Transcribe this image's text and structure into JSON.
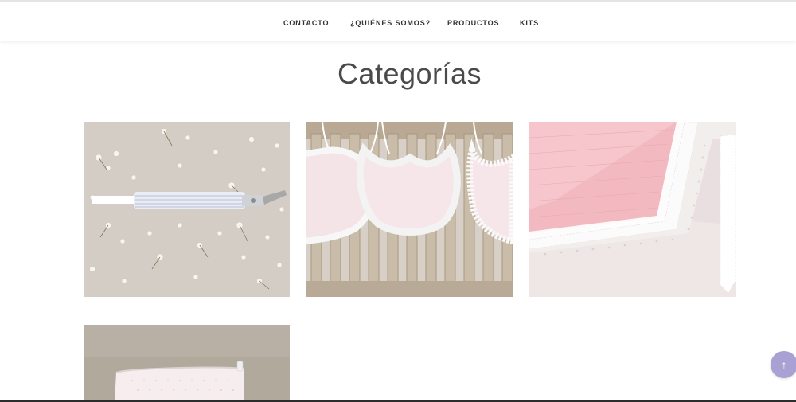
{
  "nav": {
    "items": [
      {
        "label": "CONTACTO"
      },
      {
        "label": "¿QUIÉNES SOMOS?"
      },
      {
        "label": "PRODUCTOS"
      },
      {
        "label": "KITS"
      }
    ]
  },
  "main": {
    "title": "Categorías",
    "categories": [
      {
        "icon": "pacifier-clip-photo"
      },
      {
        "icon": "baby-bibs-photo"
      },
      {
        "icon": "pink-blanket-photo"
      },
      {
        "icon": "toiletry-bag-photo"
      }
    ]
  },
  "scroll_top": {
    "icon": "arrow-up-icon",
    "glyph": "↑",
    "color": "#a9a1d4"
  }
}
